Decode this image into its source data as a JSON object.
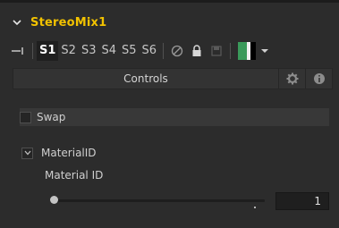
{
  "header": {
    "tool_name": "StereoMix1"
  },
  "toolbar": {
    "slots": [
      "S1",
      "S2",
      "S3",
      "S4",
      "S5",
      "S6"
    ],
    "active_slot": "S1",
    "icons": [
      "pin-icon",
      "disable-icon",
      "lock-icon",
      "save-icon",
      "color-swatch",
      "dropdown-caret-icon"
    ]
  },
  "tabs": {
    "controls_label": "Controls",
    "icons": [
      "settings-gear-icon",
      "info-icon"
    ]
  },
  "panel": {
    "swap_label": "Swap",
    "swap_checked": false,
    "material_section_label": "MaterialID",
    "material_id_label": "Material ID",
    "material_id_value": "1",
    "slider_position": 0.0
  },
  "colors": {
    "background": "#2c2c2c",
    "tool_name": "#f2c200",
    "active_slot_bg": "#1f1f1f",
    "swatch_green": "#3a9a5a"
  }
}
